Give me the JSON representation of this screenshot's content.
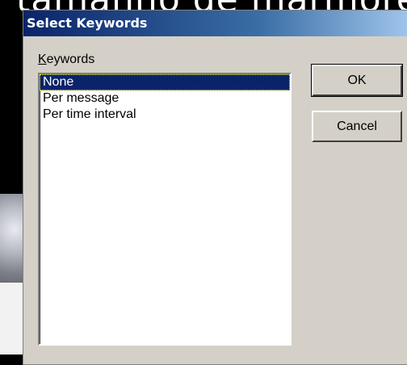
{
  "background": {
    "text": "tamanho de mármore"
  },
  "dialog": {
    "title": "Select Keywords",
    "close_icon": "close-icon",
    "keywords_label_mnemonic": "K",
    "keywords_label_rest": "eywords",
    "items": [
      {
        "label": "None",
        "selected": true
      },
      {
        "label": "Per message",
        "selected": false
      },
      {
        "label": "Per time interval",
        "selected": false
      }
    ],
    "ok_label": "OK",
    "cancel_label": "Cancel"
  },
  "colors": {
    "title_bar": "#0a246a",
    "dialog_face": "#d4d0c8",
    "selection": "#0a246a"
  }
}
